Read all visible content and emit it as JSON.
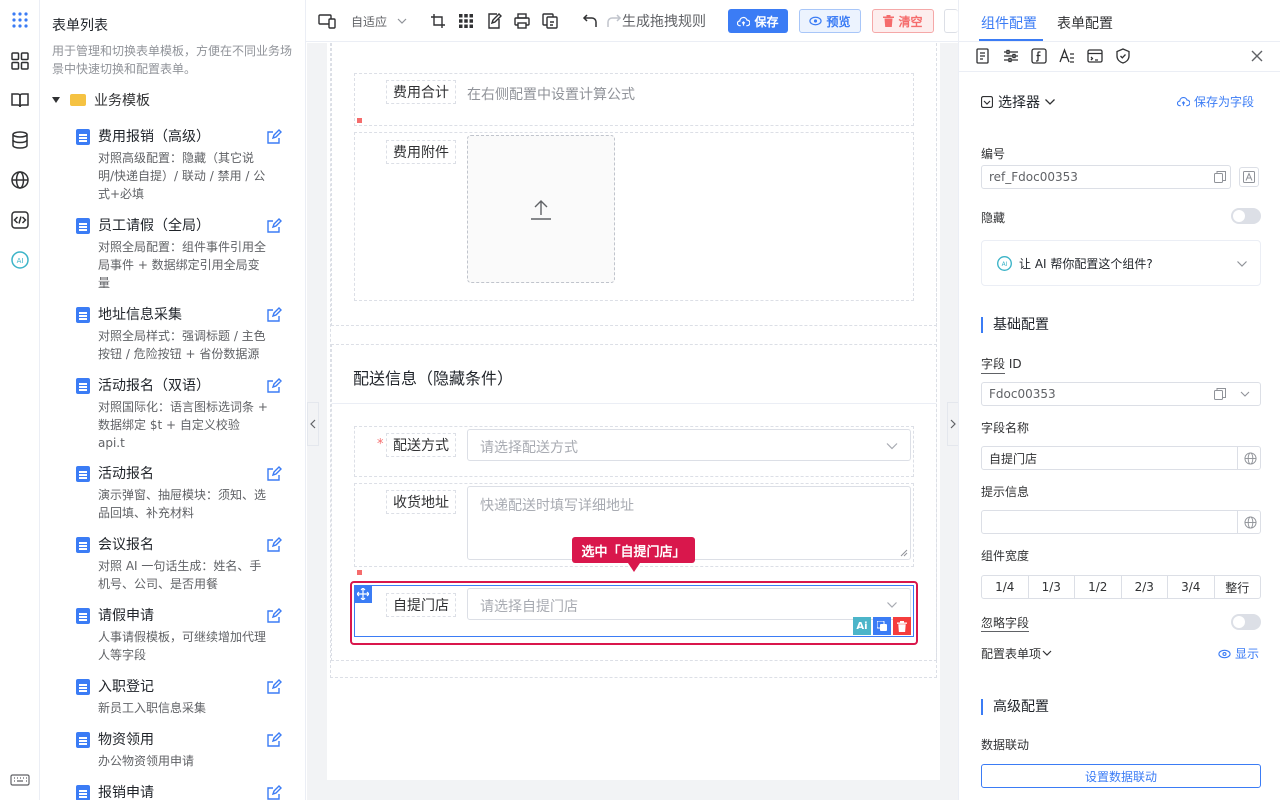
{
  "rail": {
    "icons": [
      "apps-grid-icon",
      "components-icon",
      "book-icon",
      "database-icon",
      "globe-icon",
      "code-icon",
      "ai-icon",
      "keyboard-icon"
    ]
  },
  "template_list": {
    "title": "表单列表",
    "description": "用于管理和切换表单模板，方便在不同业务场景中快速切换和配置表单。",
    "group": "业务模板",
    "items": [
      {
        "name": "费用报销（高级）",
        "desc": "对照高级配置：隐藏（其它说明/快递自提）/ 联动 / 禁用 / 公式+必填"
      },
      {
        "name": "员工请假（全局）",
        "desc": "对照全局配置：组件事件引用全局事件 + 数据绑定引用全局变量"
      },
      {
        "name": "地址信息采集",
        "desc": "对照全局样式：强调标题 / 主色按钮 / 危险按钮 + 省份数据源"
      },
      {
        "name": "活动报名（双语）",
        "desc": "对照国际化：语言图标选词条 + 数据绑定 $t + 自定义校验 api.t"
      },
      {
        "name": "活动报名",
        "desc": "演示弹窗、抽屉模块：须知、选品回填、补充材料"
      },
      {
        "name": "会议报名",
        "desc": "对照 AI 一句话生成：姓名、手机号、公司、是否用餐"
      },
      {
        "name": "请假申请",
        "desc": "人事请假模板，可继续增加代理人等字段"
      },
      {
        "name": "入职登记",
        "desc": "新员工入职信息采集"
      },
      {
        "name": "物资领用",
        "desc": "办公物资领用申请"
      },
      {
        "name": "报销申请",
        "desc": ""
      }
    ]
  },
  "toolbar": {
    "adapt": "自适应",
    "gen_rule": "生成拖拽规则",
    "save": "保存",
    "preview": "预览",
    "clear": "清空"
  },
  "canvas": {
    "fee_total_label": "费用合计",
    "fee_total_hint": "在右侧配置中设置计算公式",
    "fee_attach_label": "费用附件",
    "delivery_title": "配送信息（隐藏条件）",
    "delivery_method_label": "配送方式",
    "delivery_method_required": "*",
    "delivery_method_ph": "请选择配送方式",
    "address_label": "收货地址",
    "address_ph": "快递配送时填写详细地址",
    "pickup_label": "自提门店",
    "pickup_ph": "请选择自提门店",
    "callout": "选中「自提门店」",
    "ai_badge": "Ai"
  },
  "right_panel": {
    "tabs": [
      "组件配置",
      "表单配置"
    ],
    "component_type": "选择器",
    "save_as_field": "保存为字段",
    "id_label": "编号",
    "id_value": "ref_Fdoc00353",
    "hidden_label": "隐藏",
    "ai_prompt": "让 AI 帮你配置这个组件?",
    "basic_section": "基础配置",
    "field_id_label": "字段 ID",
    "field_id_value": "Fdoc00353",
    "field_name_label": "字段名称",
    "field_name_value": "自提门店",
    "hint_label": "提示信息",
    "hint_value": "",
    "width_label": "组件宽度",
    "width_options": [
      "1/4",
      "1/3",
      "1/2",
      "2/3",
      "3/4",
      "整行"
    ],
    "ignore_label": "忽略字段",
    "form_item_label": "配置表单项",
    "show_label": "显示",
    "advanced_section": "高级配置",
    "linkage_label": "数据联动",
    "linkage_button": "设置数据联动"
  },
  "colors": {
    "primary": "#3b7cf5",
    "danger": "#f56c6c",
    "highlight": "#d9174c"
  }
}
